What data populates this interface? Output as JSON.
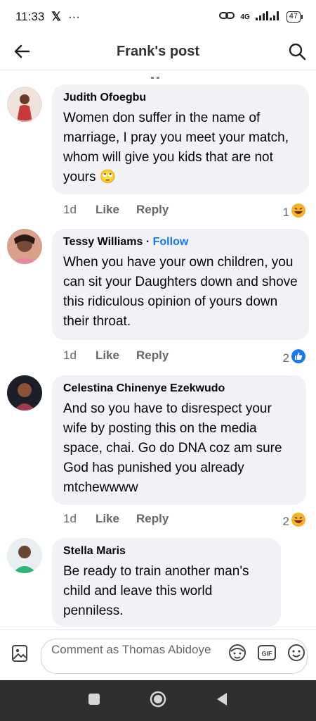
{
  "status_bar": {
    "time": "11:33",
    "x_app": "𝕏",
    "more": "···",
    "network": "4G",
    "battery": "47"
  },
  "header": {
    "title": "Frank's post"
  },
  "comments": [
    {
      "author": "Judith Ofoegbu",
      "text": "Women don suffer in the name of marriage, I pray you meet your match, whom will give you kids that are not yours 🙄",
      "time": "1d",
      "like": "Like",
      "reply": "Reply",
      "reaction_count": "1",
      "reaction": "haha"
    },
    {
      "author": "Tessy Williams",
      "separator": "·",
      "follow": "Follow",
      "text": "When you have your own children, you can sit your Daughters down and shove this ridiculous opinion of yours down their throat.",
      "time": "1d",
      "like": "Like",
      "reply": "Reply",
      "reaction_count": "2",
      "reaction": "like"
    },
    {
      "author": "Celestina Chinenye Ezekwudo",
      "text": "And so you have to disrespect your wife by posting this on the media space, chai. Go do DNA coz am sure God has punished you already mtchewwww",
      "time": "1d",
      "like": "Like",
      "reply": "Reply",
      "reaction_count": "2",
      "reaction": "haha"
    },
    {
      "author": "Stella Maris",
      "text": "Be ready to train another man's child and leave this world penniless."
    }
  ],
  "composer": {
    "placeholder": "Comment as Thomas Abidoye"
  },
  "colors": {
    "accent": "#1877f2",
    "bubble": "#f0f2f5",
    "secondary_text": "#65676b"
  }
}
